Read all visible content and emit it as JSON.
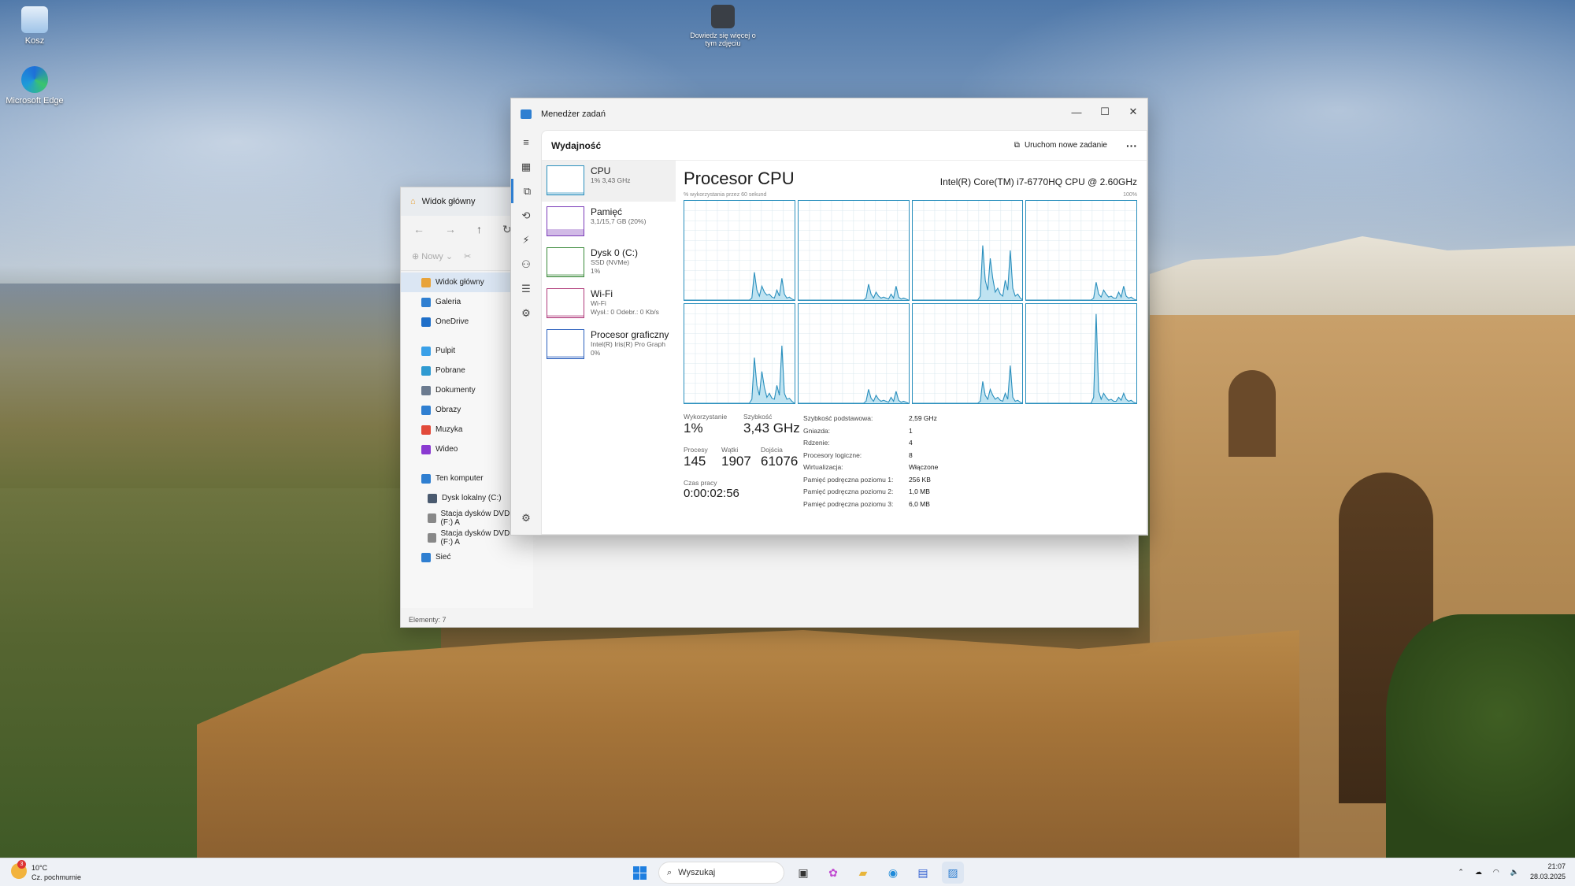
{
  "desktop": {
    "icons": [
      {
        "label": "Kosz",
        "icon": "recycle-bin-icon"
      },
      {
        "label": "Microsoft Edge",
        "icon": "edge-icon"
      },
      {
        "label": "Dowiedz się więcej o tym zdjęciu",
        "icon": "camera-info-icon"
      }
    ]
  },
  "explorer": {
    "tab_title": "Widok główny",
    "toolbar_new": "Nowy",
    "sidebar": [
      {
        "label": "Widok główny",
        "selected": true,
        "color": "#e8a33a"
      },
      {
        "label": "Galeria",
        "color": "#2f7fd1"
      },
      {
        "label": "OneDrive",
        "color": "#1f6fc9"
      },
      {
        "label": "Pulpit",
        "color": "#3aa0e8"
      },
      {
        "label": "Pobrane",
        "color": "#2f9ad1"
      },
      {
        "label": "Dokumenty",
        "color": "#6b7a8f"
      },
      {
        "label": "Obrazy",
        "color": "#2f7fd1"
      },
      {
        "label": "Muzyka",
        "color": "#e24a3a"
      },
      {
        "label": "Wideo",
        "color": "#8a3ad1"
      },
      {
        "label": "Ten komputer",
        "color": "#2f7fd1"
      },
      {
        "label": "Dysk lokalny (C:)",
        "color": "#4a5a6f"
      },
      {
        "label": "Stacja dysków DVD RW (F:) A",
        "color": "#888888"
      },
      {
        "label": "Stacja dysków DVD RW (F:) A",
        "color": "#888888"
      },
      {
        "label": "Sieć",
        "color": "#2f7fd1"
      }
    ],
    "status": "Elementy: 7"
  },
  "taskmgr": {
    "window_title": "Menedżer zadań",
    "section_title": "Wydajność",
    "run_new_task": "Uruchom nowe zadanie",
    "more": "···",
    "resources": [
      {
        "name": "CPU",
        "sub1": "1% 3,43 GHz",
        "sub2": "",
        "sub3": ""
      },
      {
        "name": "Pamięć",
        "sub1": "3,1/15,7 GB (20%)",
        "sub2": "",
        "sub3": ""
      },
      {
        "name": "Dysk 0 (C:)",
        "sub1": "SSD (NVMe)",
        "sub2": "1%",
        "sub3": ""
      },
      {
        "name": "Wi-Fi",
        "sub1": "Wi-Fi",
        "sub2": "Wysł.: 0 Odebr.: 0 Kb/s",
        "sub3": ""
      },
      {
        "name": "Procesor graficzny",
        "sub1": "Intel(R) Iris(R) Pro Graph",
        "sub2": "0%",
        "sub3": ""
      }
    ],
    "cpu": {
      "title": "Procesor CPU",
      "model": "Intel(R) Core(TM) i7-6770HQ CPU @ 2.60GHz",
      "caption_left": "% wykorzystania przez 60 sekund",
      "caption_right": "100%",
      "util_label": "Wykorzystanie",
      "util_value": "1%",
      "speed_label": "Szybkość",
      "speed_value": "3,43 GHz",
      "proc_label": "Procesy",
      "proc_value": "145",
      "threads_label": "Wątki",
      "threads_value": "1907",
      "handles_label": "Dojścia",
      "handles_value": "61076",
      "uptime_label": "Czas pracy",
      "uptime_value": "0:00:02:56",
      "specs": [
        {
          "k": "Szybkość podstawowa:",
          "v": "2,59 GHz"
        },
        {
          "k": "Gniazda:",
          "v": "1"
        },
        {
          "k": "Rdzenie:",
          "v": "4"
        },
        {
          "k": "Procesory logiczne:",
          "v": "8"
        },
        {
          "k": "Wirtualizacja:",
          "v": "Włączone"
        },
        {
          "k": "Pamięć podręczna poziomu 1:",
          "v": "256 KB"
        },
        {
          "k": "Pamięć podręczna poziomu 2:",
          "v": "1,0 MB"
        },
        {
          "k": "Pamięć podręczna poziomu 3:",
          "v": "6,0 MB"
        }
      ],
      "core_graphs": [
        [
          0,
          0,
          0,
          0,
          0,
          0,
          0,
          0,
          0,
          0,
          0,
          0,
          0,
          0,
          0,
          0,
          0,
          0,
          0,
          0,
          0,
          0,
          0,
          0,
          0,
          0,
          0,
          2,
          28,
          10,
          4,
          14,
          8,
          5,
          6,
          3,
          2,
          10,
          4,
          22,
          6,
          2,
          3,
          1,
          0
        ],
        [
          0,
          0,
          0,
          0,
          0,
          0,
          0,
          0,
          0,
          0,
          0,
          0,
          0,
          0,
          0,
          0,
          0,
          0,
          0,
          0,
          0,
          0,
          0,
          0,
          0,
          0,
          0,
          2,
          16,
          6,
          2,
          8,
          4,
          2,
          3,
          2,
          1,
          6,
          2,
          14,
          3,
          1,
          2,
          1,
          0
        ],
        [
          0,
          0,
          0,
          0,
          0,
          0,
          0,
          0,
          0,
          0,
          0,
          0,
          0,
          0,
          0,
          0,
          0,
          0,
          0,
          0,
          0,
          0,
          0,
          0,
          0,
          0,
          0,
          4,
          55,
          20,
          10,
          42,
          22,
          8,
          12,
          6,
          4,
          20,
          10,
          50,
          12,
          4,
          6,
          2,
          0
        ],
        [
          0,
          0,
          0,
          0,
          0,
          0,
          0,
          0,
          0,
          0,
          0,
          0,
          0,
          0,
          0,
          0,
          0,
          0,
          0,
          0,
          0,
          0,
          0,
          0,
          0,
          0,
          0,
          2,
          18,
          6,
          3,
          10,
          6,
          3,
          4,
          2,
          2,
          8,
          3,
          14,
          4,
          2,
          3,
          1,
          0
        ],
        [
          0,
          0,
          0,
          0,
          0,
          0,
          0,
          0,
          0,
          0,
          0,
          0,
          0,
          0,
          0,
          0,
          0,
          0,
          0,
          0,
          0,
          0,
          0,
          0,
          0,
          0,
          0,
          4,
          46,
          18,
          8,
          32,
          16,
          6,
          10,
          5,
          4,
          18,
          8,
          58,
          10,
          4,
          5,
          2,
          0
        ],
        [
          0,
          0,
          0,
          0,
          0,
          0,
          0,
          0,
          0,
          0,
          0,
          0,
          0,
          0,
          0,
          0,
          0,
          0,
          0,
          0,
          0,
          0,
          0,
          0,
          0,
          0,
          0,
          2,
          14,
          5,
          2,
          8,
          4,
          2,
          3,
          2,
          1,
          6,
          2,
          12,
          3,
          1,
          2,
          1,
          0
        ],
        [
          0,
          0,
          0,
          0,
          0,
          0,
          0,
          0,
          0,
          0,
          0,
          0,
          0,
          0,
          0,
          0,
          0,
          0,
          0,
          0,
          0,
          0,
          0,
          0,
          0,
          0,
          0,
          2,
          22,
          8,
          4,
          14,
          8,
          4,
          6,
          3,
          2,
          10,
          4,
          38,
          6,
          2,
          3,
          1,
          0
        ],
        [
          0,
          0,
          0,
          0,
          0,
          0,
          0,
          0,
          0,
          0,
          0,
          0,
          0,
          0,
          0,
          0,
          0,
          0,
          0,
          0,
          0,
          0,
          0,
          0,
          0,
          0,
          0,
          6,
          90,
          12,
          4,
          10,
          6,
          3,
          4,
          2,
          2,
          6,
          3,
          10,
          4,
          2,
          3,
          1,
          0
        ]
      ]
    }
  },
  "taskbar": {
    "weather_temp": "10°C",
    "weather_desc": "Cz. pochmurnie",
    "weather_badge": "3",
    "search_placeholder": "Wyszukaj",
    "time": "21:07",
    "date": "28.03.2025"
  },
  "colors": {
    "accent": "#2f7fd1",
    "graph_line": "#2a8fbd",
    "graph_fill": "#bfe3f1"
  }
}
